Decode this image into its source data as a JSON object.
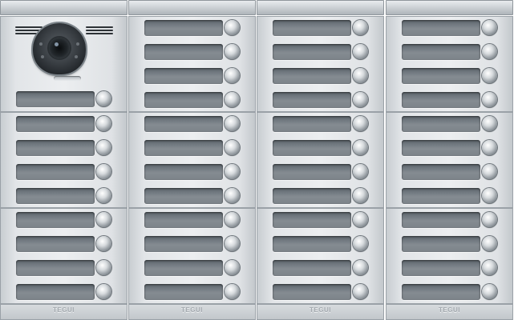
{
  "panel": {
    "brand_label": "TEGUI",
    "column_count": 4,
    "colors": {
      "aluminium": "#e2e5e8",
      "nameplate": "#7c8389",
      "bell_button": "#d6dadd",
      "camera_housing": "#2a2f33"
    },
    "camera_module": {
      "speaker_grille": "speaker-grille-icon",
      "camera": "camera-lens-icon"
    },
    "call_button_icon": "round-push-button-icon",
    "name_plate_icon": "blank-name-card-icon"
  }
}
